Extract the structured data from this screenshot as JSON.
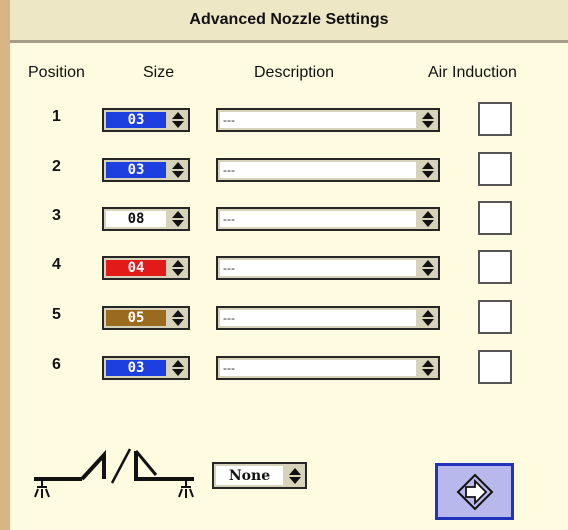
{
  "title": "Advanced Nozzle Settings",
  "headers": {
    "position": "Position",
    "size": "Size",
    "description": "Description",
    "air_induction": "Air Induction"
  },
  "rows": [
    {
      "position": "1",
      "size": "03",
      "size_color": "#1e3fe0",
      "size_text_color": "#ffffff",
      "description": "---",
      "air_induction": false
    },
    {
      "position": "2",
      "size": "03",
      "size_color": "#1e3fe0",
      "size_text_color": "#ffffff",
      "description": "---",
      "air_induction": false
    },
    {
      "position": "3",
      "size": "08",
      "size_color": "#ffffff",
      "size_text_color": "#111111",
      "description": "---",
      "air_induction": false
    },
    {
      "position": "4",
      "size": "04",
      "size_color": "#e21a1a",
      "size_text_color": "#ffffff",
      "description": "---",
      "air_induction": false
    },
    {
      "position": "5",
      "size": "05",
      "size_color": "#9a6a1e",
      "size_text_color": "#ffffff",
      "description": "---",
      "air_induction": false
    },
    {
      "position": "6",
      "size": "03",
      "size_color": "#1e3fe0",
      "size_text_color": "#ffffff",
      "description": "---",
      "air_induction": false
    }
  ],
  "boom_mode": {
    "icon": "boom-spray-icon",
    "selected": "None"
  },
  "next_button": {
    "icon": "next-arrow-icon"
  },
  "colors": {
    "panel_bg": "#fffbe0",
    "title_bg": "#eee7c6",
    "frame": "#dcb98a",
    "next_button_bg": "#b9b8ec",
    "next_button_border": "#2233bb"
  }
}
